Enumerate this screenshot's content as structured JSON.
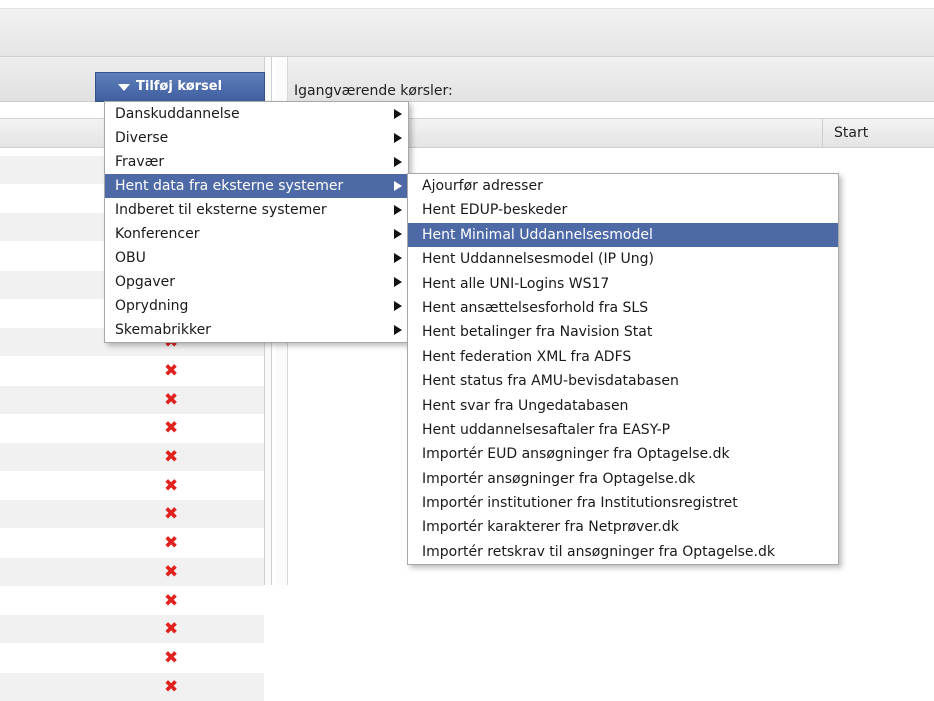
{
  "toolbar": {
    "add_button_label": "Tilføj kørsel"
  },
  "right_panel": {
    "title": "Igangværende kørsler:",
    "columns": [
      "Start"
    ]
  },
  "left_panel": {
    "row_count": 19,
    "delete_glyph": "✖"
  },
  "main_menu": {
    "items": [
      {
        "label": "Danskuddannelse",
        "submenu": true
      },
      {
        "label": "Diverse",
        "submenu": true
      },
      {
        "label": "Fravær",
        "submenu": true
      },
      {
        "label": "Hent data fra eksterne systemer",
        "submenu": true,
        "active": true
      },
      {
        "label": "Indberet til eksterne systemer",
        "submenu": true
      },
      {
        "label": "Konferencer",
        "submenu": true
      },
      {
        "label": "OBU",
        "submenu": true
      },
      {
        "label": "Opgaver",
        "submenu": true
      },
      {
        "label": "Oprydning",
        "submenu": true
      },
      {
        "label": "Skemabrikker",
        "submenu": true
      }
    ]
  },
  "sub_menu": {
    "items": [
      {
        "label": "Ajourfør adresser"
      },
      {
        "label": "Hent EDUP-beskeder"
      },
      {
        "label": "Hent Minimal Uddannelsesmodel",
        "active": true
      },
      {
        "label": "Hent Uddannelsesmodel (IP Ung)"
      },
      {
        "label": "Hent alle UNI-Logins WS17"
      },
      {
        "label": "Hent ansættelsesforhold fra SLS"
      },
      {
        "label": "Hent betalinger fra Navision Stat"
      },
      {
        "label": "Hent federation XML fra ADFS"
      },
      {
        "label": "Hent status fra AMU-bevisdatabasen"
      },
      {
        "label": "Hent svar fra Ungedatabasen"
      },
      {
        "label": "Hent uddannelsesaftaler fra EASY-P"
      },
      {
        "label": "Importér EUD ansøgninger fra Optagelse.dk"
      },
      {
        "label": "Importér ansøgninger fra Optagelse.dk"
      },
      {
        "label": "Importér institutioner fra Institutionsregistret"
      },
      {
        "label": "Importér karakterer fra Netprøver.dk"
      },
      {
        "label": "Importér retskrav til ansøgninger fra Optagelse.dk"
      }
    ]
  },
  "colors": {
    "accent": "#4e6aa6",
    "delete": "#e0221e"
  }
}
